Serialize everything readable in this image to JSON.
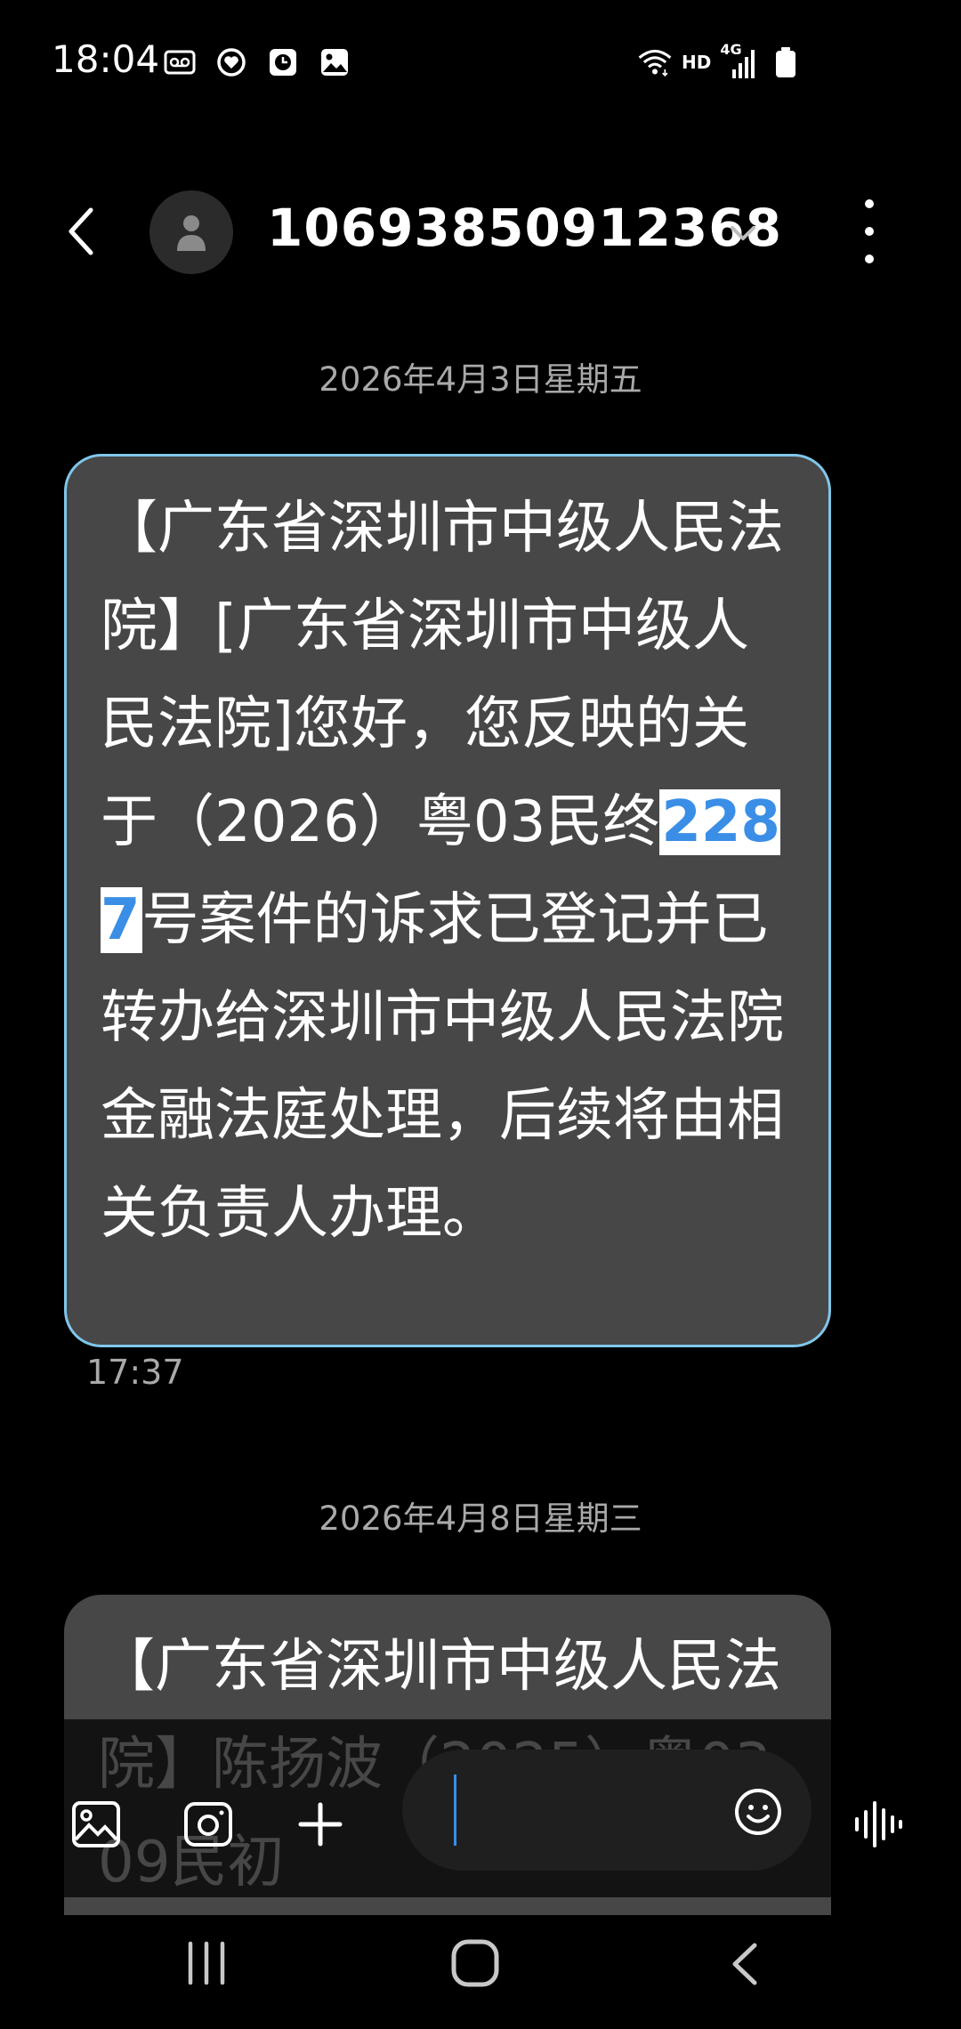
{
  "status_bar": {
    "time": "18:04",
    "left_icons": [
      "voicemail-icon",
      "heart-shield-icon",
      "clock-app-icon",
      "gallery-icon"
    ],
    "right_icons": [
      "wifi-icon",
      "hd-icon",
      "signal-icon",
      "battery-icon"
    ],
    "hd_label": "HD",
    "network_label": "4G"
  },
  "header": {
    "contact_name": "10693850912368"
  },
  "messages": [
    {
      "date": "2026年4月3日星期五",
      "text_before": "【广东省深圳市中级人民法院】[广东省深圳市中级人民法院]您好，您反映的关于（2026）粤03民终",
      "text_highlight": "2287",
      "text_after": "号案件的诉求已登记并已转办给深圳市中级人民法院金融法庭处理，后续将由相关负责人办理。",
      "time": "17:37",
      "selected": true
    },
    {
      "date": "2026年4月8日星期三",
      "text": "【广东省深圳市中级人民法院】陈扬波（2025）粤0309民初",
      "selected": false
    }
  ],
  "composer": {
    "input_value": "",
    "buttons": [
      "image-icon",
      "camera-icon",
      "plus-icon",
      "emoji-icon",
      "voice-icon"
    ]
  },
  "nav_bar": {
    "buttons": [
      "recent-apps-icon",
      "home-icon",
      "back-icon"
    ]
  },
  "colors": {
    "background": "#000000",
    "bubble": "#474747",
    "selected_border": "#7fc7ea",
    "highlight_text": "#3a8ee6",
    "secondary_text": "#a9a9a9"
  }
}
